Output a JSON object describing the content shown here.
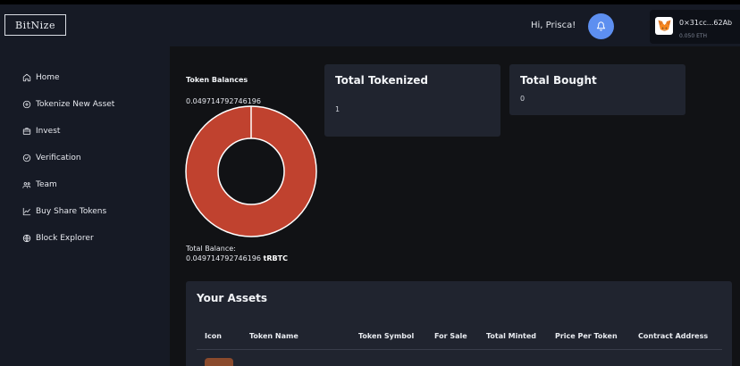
{
  "brand": {
    "logo_text": "BitNize"
  },
  "header": {
    "greeting": "Hi, Prisca!",
    "wallet_address": "0×31cc...62Ab",
    "wallet_balance": "0.050 ETH"
  },
  "sidebar": {
    "items": [
      {
        "label": "Home",
        "icon": "home-icon"
      },
      {
        "label": "Tokenize New Asset",
        "icon": "plus-circle-icon"
      },
      {
        "label": "Invest",
        "icon": "briefcase-icon"
      },
      {
        "label": "Verification",
        "icon": "check-circle-icon"
      },
      {
        "label": "Team",
        "icon": "team-icon"
      },
      {
        "label": "Buy Share Tokens",
        "icon": "chart-line-icon"
      },
      {
        "label": "Block Explorer",
        "icon": "globe-icon"
      }
    ]
  },
  "token_balances": {
    "title": "Token Balances",
    "value": "0.049714792746196",
    "total_label": "Total Balance:",
    "total_value": "0.049714792746196",
    "unit": "tRBTC",
    "fraction": 1.0,
    "color": "#c0422f"
  },
  "cards": [
    {
      "title": "Total Tokenized",
      "value": "1"
    },
    {
      "title": "Total Bought",
      "value": "0"
    }
  ],
  "assets": {
    "title": "Your Assets",
    "columns": [
      "Icon",
      "Token Name",
      "Token Symbol",
      "For Sale",
      "Total Minted",
      "Price Per Token",
      "Contract Address"
    ]
  }
}
